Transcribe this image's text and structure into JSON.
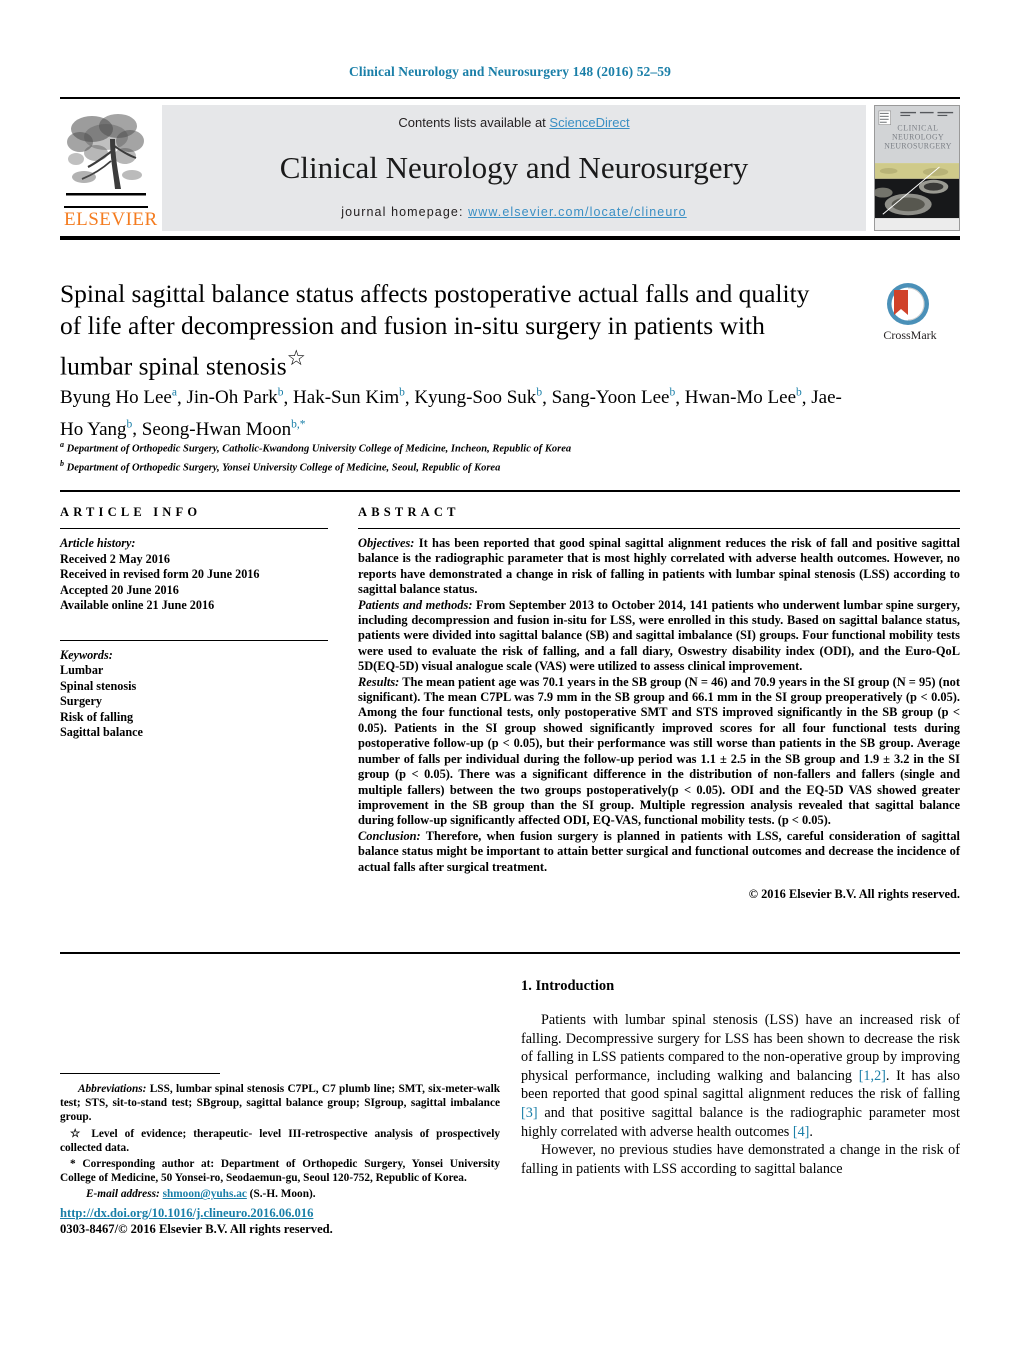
{
  "running_head": "Clinical Neurology and Neurosurgery 148 (2016) 52–59",
  "masthead": {
    "contents_prefix": "Contents lists available at ",
    "sciencedirect": "ScienceDirect",
    "journal_title": "Clinical Neurology and Neurosurgery",
    "homepage_prefix": "journal homepage: ",
    "homepage_url": "www.elsevier.com/locate/clineuro",
    "publisher": "ELSEVIER",
    "cover_title_line1": "CLINICAL",
    "cover_title_line2": "NEUROLOGY &",
    "cover_title_line3": "NEUROSURGERY"
  },
  "article": {
    "title": "Spinal sagittal balance status affects postoperative actual falls and quality of life after decompression and fusion in-situ surgery in patients with lumbar spinal stenosis",
    "title_marker": "☆",
    "crossmark_label": "CrossMark"
  },
  "authors": [
    {
      "name": "Byung Ho Lee",
      "sup": "a"
    },
    {
      "name": "Jin-Oh Park",
      "sup": "b"
    },
    {
      "name": "Hak-Sun Kim",
      "sup": "b"
    },
    {
      "name": "Kyung-Soo Suk",
      "sup": "b"
    },
    {
      "name": "Sang-Yoon Lee",
      "sup": "b"
    },
    {
      "name": "Hwan-Mo Lee",
      "sup": "b"
    },
    {
      "name": "Jae-Ho Yang",
      "sup": "b"
    },
    {
      "name": "Seong-Hwan Moon",
      "sup": "b,*"
    }
  ],
  "affiliations": [
    {
      "sup": "a",
      "text": "Department of Orthopedic Surgery, Catholic-Kwandong University College of Medicine, Incheon, Republic of Korea"
    },
    {
      "sup": "b",
      "text": "Department of Orthopedic Surgery, Yonsei University College of Medicine, Seoul, Republic of Korea"
    }
  ],
  "article_info": {
    "heading": "ARTICLE INFO",
    "history_label": "Article history:",
    "history": [
      "Received 2 May 2016",
      "Received in revised form 20 June 2016",
      "Accepted 20 June 2016",
      "Available online 21 June 2016"
    ],
    "keywords_label": "Keywords:",
    "keywords": [
      "Lumbar",
      "Spinal stenosis",
      "Surgery",
      "Risk of falling",
      "Sagittal balance"
    ]
  },
  "abstract": {
    "heading": "ABSTRACT",
    "sections": [
      {
        "label": "Objectives:",
        "text": " It has been reported that good spinal sagittal alignment reduces the risk of fall and positive sagittal balance is the radiographic parameter that is most highly correlated with adverse health outcomes. However, no reports have demonstrated a change in risk of falling in patients with lumbar spinal stenosis (LSS) according to sagittal balance status."
      },
      {
        "label": "Patients and methods:",
        "text": " From September 2013 to October 2014, 141 patients who underwent lumbar spine surgery, including decompression and fusion in-situ for LSS, were enrolled in this study. Based on sagittal balance status, patients were divided into sagittal balance (SB) and sagittal imbalance (SI) groups. Four functional mobility tests were used to evaluate the risk of falling, and a fall diary, Oswestry disability index (ODI), and the Euro-QoL 5D(EQ-5D) visual analogue scale (VAS) were utilized to assess clinical improvement."
      },
      {
        "label": "Results:",
        "text": " The mean patient age was 70.1 years in the SB group (N = 46) and 70.9 years in the SI group (N = 95) (not significant). The mean C7PL was 7.9 mm in the SB group and 66.1 mm in the SI group preoperatively (p < 0.05). Among the four functional tests, only postoperative SMT and STS improved significantly in the SB group (p < 0.05). Patients in the SI group showed significantly improved scores for all four functional tests during postoperative follow-up (p < 0.05), but their performance was still worse than patients in the SB group. Average number of falls per individual during the follow-up period was 1.1 ± 2.5 in the SB group and 1.9 ± 3.2 in the SI group (p < 0.05). There was a significant difference in the distribution of non-fallers and fallers (single and multiple fallers) between the two groups postoperatively(p < 0.05). ODI and the EQ-5D VAS showed greater improvement in the SB group than the SI group. Multiple regression analysis revealed that sagittal balance during follow-up significantly affected ODI, EQ-VAS, functional mobility tests. (p < 0.05)."
      },
      {
        "label": "Conclusion:",
        "text": " Therefore, when fusion surgery is planned in patients with LSS, careful consideration of sagittal balance status might be important to attain better surgical and functional outcomes and decrease the incidence of actual falls after surgical treatment."
      }
    ],
    "copyright": "© 2016 Elsevier B.V. All rights reserved."
  },
  "introduction": {
    "heading": "1.  Introduction",
    "paragraph1_a": "Patients with lumbar spinal stenosis (LSS) have an increased risk of falling. Decompressive surgery for LSS has been shown to decrease the risk of falling in LSS patients compared to the non-operative group by improving physical performance, including walking and balancing ",
    "paragraph1_ref1": "[1,2]",
    "paragraph1_b": ". It has also been reported that good spinal sagittal alignment reduces the risk of falling ",
    "paragraph1_ref2": "[3]",
    "paragraph1_c": " and that positive sagittal balance is the radiographic parameter most highly correlated with adverse health outcomes ",
    "paragraph1_ref3": "[4]",
    "paragraph1_d": ".",
    "paragraph2": "However, no previous studies have demonstrated a change in the risk of falling in patients with LSS according to sagittal balance"
  },
  "footnotes": {
    "abbrev_label": "Abbreviations:",
    "abbrev_text": "  LSS, lumbar spinal stenosis C7PL, C7 plumb line; SMT, six-meter-walk test; STS, sit-to-stand test; SBgroup, sagittal balance group; SIgroup, sagittal imbalance group.",
    "star_marker": "☆",
    "star_text": " Level of evidence; therapeutic- level III-retrospective analysis of prospectively collected data.",
    "corr_marker": "*",
    "corr_text": " Corresponding author at: Department of Orthopedic Surgery, Yonsei University College of Medicine, 50 Yonsei-ro, Seodaemun-gu, Seoul 120-752, Republic of Korea.",
    "email_label": "E-mail address:",
    "email": "shmoon@yuhs.ac",
    "email_suffix": " (S.-H. Moon)."
  },
  "doi": {
    "url": "http://dx.doi.org/10.1016/j.clineuro.2016.06.016",
    "issn_line": "0303-8467/© 2016 Elsevier B.V. All rights reserved."
  },
  "colors": {
    "link": "#1a7fa8",
    "sciencedirect": "#3a8fc4",
    "elsevier_orange": "#f47c20",
    "band_gray": "#e6e7e9"
  }
}
